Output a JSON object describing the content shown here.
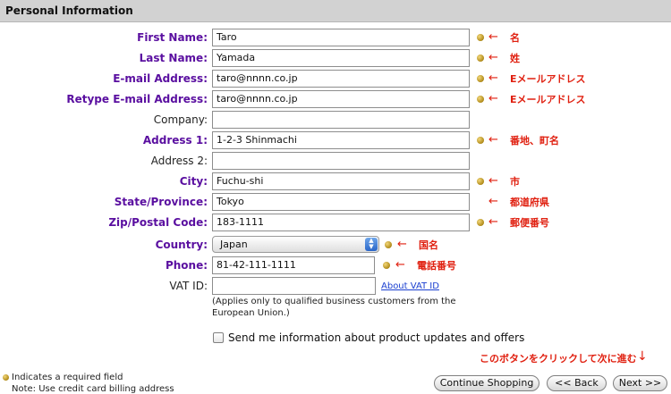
{
  "section_title": "Personal Information",
  "fields": {
    "first_name": {
      "label": "First Name:",
      "value": "Taro",
      "note": "名"
    },
    "last_name": {
      "label": "Last Name:",
      "value": "Yamada",
      "note": "姓"
    },
    "email": {
      "label": "E-mail Address:",
      "value": "taro@nnnn.co.jp",
      "note": "Eメールアドレス"
    },
    "retype_email": {
      "label": "Retype E-mail Address:",
      "value": "taro@nnnn.co.jp",
      "note": "Eメールアドレス"
    },
    "company": {
      "label": "Company:",
      "value": ""
    },
    "address1": {
      "label": "Address 1:",
      "value": "1-2-3 Shinmachi",
      "note": "番地、町名"
    },
    "address2": {
      "label": "Address 2:",
      "value": ""
    },
    "city": {
      "label": "City:",
      "value": "Fuchu-shi",
      "note": "市"
    },
    "state": {
      "label": "State/Province:",
      "value": "Tokyo",
      "note": "都道府県"
    },
    "zip": {
      "label": "Zip/Postal Code:",
      "value": "183-1111",
      "note": "郵便番号"
    },
    "country": {
      "label": "Country:",
      "value": "Japan",
      "note": "国名"
    },
    "phone": {
      "label": "Phone:",
      "value": "81-42-111-1111",
      "note": "電話番号"
    },
    "vat": {
      "label": "VAT ID:",
      "value": "",
      "link": "About VAT ID",
      "help": "(Applies only to qualified business customers from the European Union.)"
    }
  },
  "newsletter_label": "Send me information about product updates and offers",
  "legend": {
    "required": "Indicates a required field",
    "billing_note": "Note: Use credit card billing address"
  },
  "instruction": "このボタンをクリックして次に進む",
  "buttons": {
    "continue_shopping": "Continue Shopping",
    "back": "<< Back",
    "next": "Next >>"
  },
  "colors": {
    "required_label": "#5a0fa0",
    "annotation": "#e02010",
    "header_bg": "#d2d2d2"
  }
}
